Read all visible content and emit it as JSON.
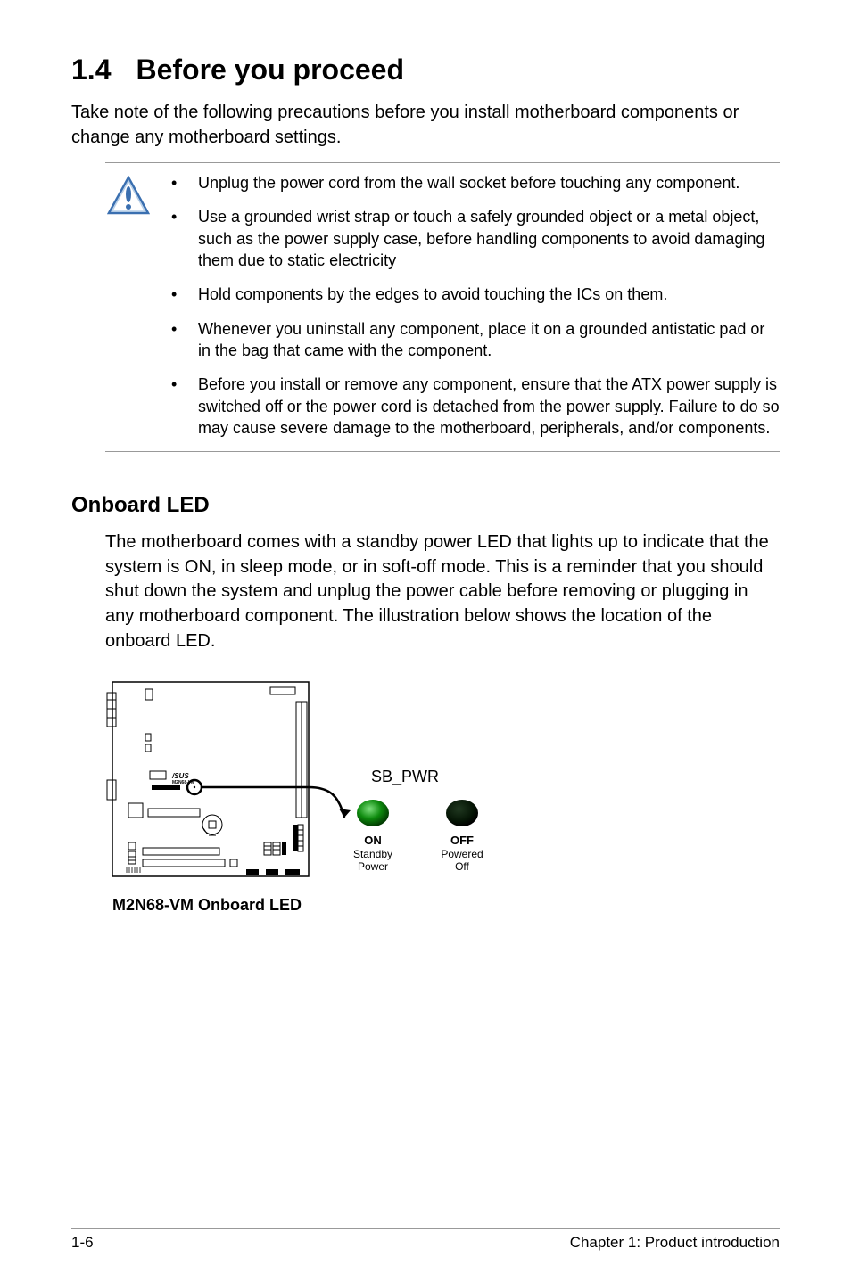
{
  "heading": {
    "number": "1.4",
    "title": "Before you proceed"
  },
  "intro": "Take note of the following precautions before you install motherboard components or change any motherboard settings.",
  "caution_icon": "caution-icon",
  "cautions": [
    "Unplug the power cord from the wall socket before touching any component.",
    "Use a grounded wrist strap or touch a safely grounded object or a metal object, such as the power supply case, before handling components to avoid damaging them due to static electricity",
    "Hold components by the edges to avoid touching the ICs on them.",
    "Whenever you uninstall any component, place it on a grounded antistatic pad or in the bag that came with the component.",
    "Before you install or remove any component, ensure that the ATX power supply is switched off or the power cord is detached from the power supply. Failure to do so may cause severe damage to the motherboard, peripherals, and/or components."
  ],
  "onboard": {
    "heading": "Onboard LED",
    "text": "The motherboard comes with a standby power LED that lights up to indicate that the system is ON, in sleep mode, or in soft-off mode. This is a reminder that you should shut down the system and unplug the power cable before removing or plugging in any motherboard component. The illustration below shows the location of the onboard LED."
  },
  "diagram": {
    "board_label": "M2N68-VM",
    "caption": "M2N68-VM Onboard LED",
    "sb_pwr_label": "SB_PWR",
    "led_on": {
      "title": "ON",
      "sub1": "Standby",
      "sub2": "Power"
    },
    "led_off": {
      "title": "OFF",
      "sub1": "Powered",
      "sub2": "Off"
    }
  },
  "footer": {
    "left": "1-6",
    "right": "Chapter 1: Product introduction"
  }
}
